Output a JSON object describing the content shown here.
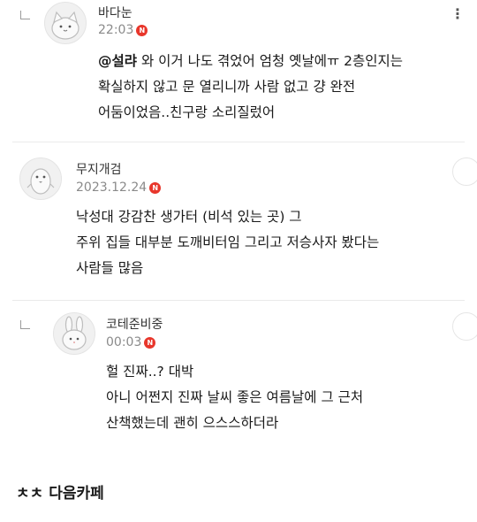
{
  "comments": [
    {
      "author": "바다눈",
      "time": "22:03",
      "new_badge": "N",
      "mention": "@설랴",
      "lines": [
        " 와 이거 나도 겪었어 엄청 옛날에ㅠ 2층인지는",
        "확실하지 않고 문 열리니까 사람 없고 걍 완전",
        "어둠이었음..친구랑 소리질렀어"
      ],
      "more_icon": "⋮"
    },
    {
      "author": "무지개검",
      "time": "2023.12.24",
      "new_badge": "N",
      "lines": [
        "낙성대 강감찬 생가터 (비석 있는 곳) 그",
        "주위 집들 대부분 도깨비터임 그리고 저승사자 봤다는",
        "사람들 많음"
      ]
    },
    {
      "author": "코테준비중",
      "time": "00:03",
      "new_badge": "N",
      "lines": [
        "헐 진짜..? 대박",
        "아니 어쩐지 진짜 날씨 좋은 여름날에 그 근처",
        "산책했는데 괜히 으스스하더라"
      ]
    }
  ],
  "source": "ㅊㅊ 다음카페"
}
